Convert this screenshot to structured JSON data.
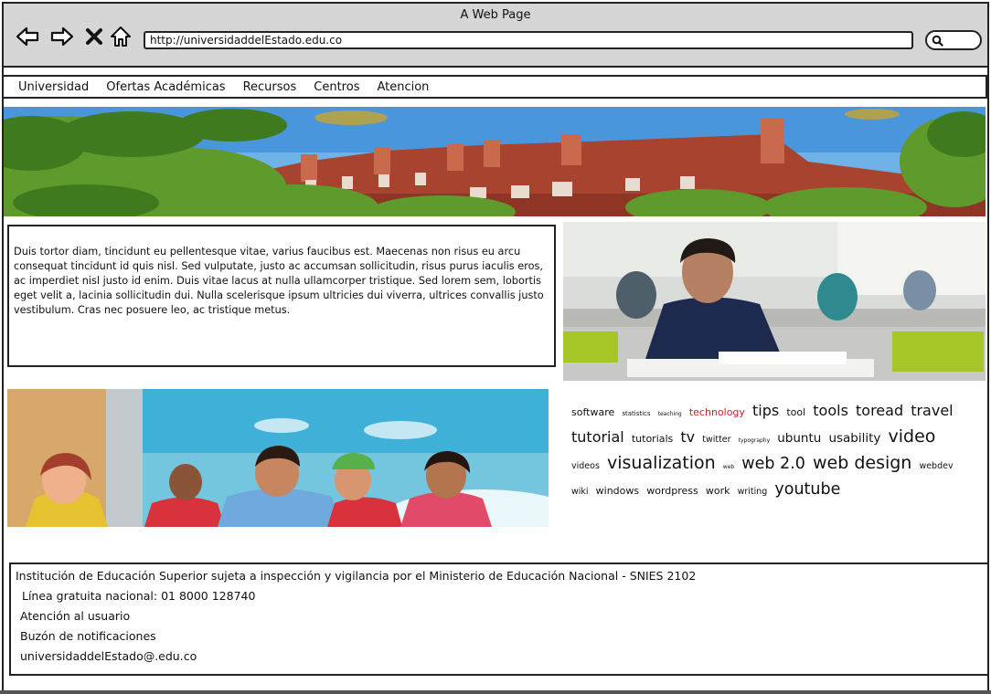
{
  "window": {
    "title": "A Web Page"
  },
  "browser": {
    "url": "http://universidaddelEstado.edu.co",
    "icons": [
      "back-arrow-icon",
      "forward-arrow-icon",
      "close-icon",
      "home-icon",
      "search-icon"
    ]
  },
  "menu": {
    "items": [
      "Universidad",
      "Ofertas Académicas",
      "Recursos",
      "Centros",
      "Atencion"
    ]
  },
  "main": {
    "paragraph": "Duis tortor diam, tincidunt eu pellentesque vitae, varius faucibus est. Maecenas non risus eu arcu consequat tincidunt id quis nisl. Sed vulputate, justo ac accumsan sollicitudin, risus purus iaculis eros, ac imperdiet nisl justo id enim. Duis vitae lacus at nulla ullamcorper tristique. Sed lorem sem, lobortis eget velit a, lacinia sollicitudin dui. Nulla scelerisque ipsum ultricies dui viverra, ultrices convallis justo vestibulum. Cras nec posuere leo, ac tristique metus."
  },
  "tag_cloud": {
    "highlight_color": "#d0202a",
    "tags": [
      {
        "text": "software",
        "size": "md"
      },
      {
        "text": "statistics",
        "size": "xs"
      },
      {
        "text": "teaching",
        "size": "xxs"
      },
      {
        "text": "technology",
        "size": "md",
        "highlight": true
      },
      {
        "text": "tips",
        "size": "lg"
      },
      {
        "text": "tool",
        "size": "md"
      },
      {
        "text": "tools",
        "size": "lg"
      },
      {
        "text": "toread",
        "size": "lg"
      },
      {
        "text": "travel",
        "size": "lg"
      },
      {
        "text": "tutorial",
        "size": "lg"
      },
      {
        "text": "tutorials",
        "size": "md"
      },
      {
        "text": "tv",
        "size": "lg"
      },
      {
        "text": "twitter",
        "size": "sm"
      },
      {
        "text": "typography",
        "size": "xxs"
      },
      {
        "text": "ubuntu",
        "size": "ml"
      },
      {
        "text": "usability",
        "size": "ml"
      },
      {
        "text": "video",
        "size": "xl"
      },
      {
        "text": "videos",
        "size": "sm"
      },
      {
        "text": "visualization",
        "size": "xl"
      },
      {
        "text": "web",
        "size": "xxs"
      },
      {
        "text": "web 2.0",
        "size": "ll"
      },
      {
        "text": "web design",
        "size": "xl"
      },
      {
        "text": "webdev",
        "size": "sm"
      },
      {
        "text": "wiki",
        "size": "sm"
      },
      {
        "text": "windows",
        "size": "md"
      },
      {
        "text": "wordpress",
        "size": "md"
      },
      {
        "text": "work",
        "size": "md"
      },
      {
        "text": "writing",
        "size": "sm"
      },
      {
        "text": "youtube",
        "size": "ll"
      }
    ]
  },
  "footer": {
    "institution": "Institución de Educación Superior sujeta a inspección y vigilancia por el Ministerio de Educación Nacional - SNIES 2102",
    "phone": "Línea gratuita nacional: 01 8000 128740",
    "attention": "Atención al usuario",
    "mailbox": "Buzón de notificaciones",
    "email": "universidaddelEstado@.edu.co"
  }
}
